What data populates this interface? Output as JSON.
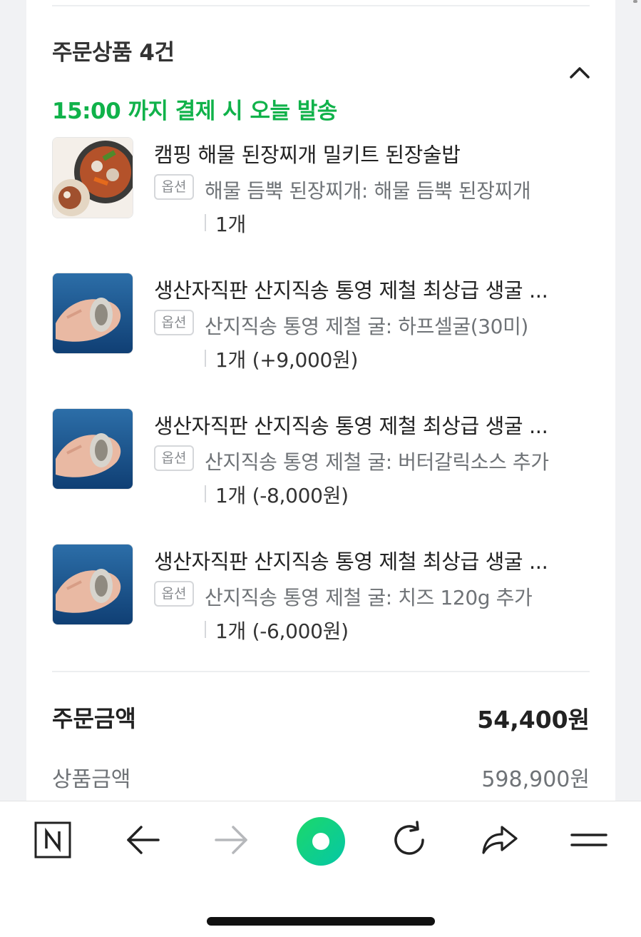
{
  "section": {
    "title": "주문상품 4건",
    "shipping_notice": "15:00 까지 결제 시 오늘 발송"
  },
  "items": [
    {
      "name": "캠핑 해물 된장찌개 밀키트 된장술밥",
      "option_badge": "옵션",
      "option": "해물 듬뿍 된장찌개: 해물 듬뿍 된장찌개",
      "quantity": "1개"
    },
    {
      "name": "생산자직판 산지직송 통영 제철 최상급 생굴 ...",
      "option_badge": "옵션",
      "option": "산지직송 통영 제철 굴: 하프셀굴(30미)",
      "quantity": "1개 (+9,000원)"
    },
    {
      "name": "생산자직판 산지직송 통영 제철 최상급 생굴 ...",
      "option_badge": "옵션",
      "option": "산지직송 통영 제철 굴: 버터갈릭소스 추가",
      "quantity": "1개 (-8,000원)"
    },
    {
      "name": "생산자직판 산지직송 통영 제철 최상급 생굴 ...",
      "option_badge": "옵션",
      "option": "산지직송 통영 제철 굴: 치즈 120g 추가",
      "quantity": "1개 (-6,000원)"
    }
  ],
  "summary": {
    "order_amount_label": "주문금액",
    "order_amount_value": "54,400원",
    "product_amount_label": "상품금액",
    "product_amount_value": "598,900원"
  },
  "toolbar": {
    "home_icon": "naver-n-icon",
    "back_icon": "arrow-left-icon",
    "forward_icon": "arrow-right-icon",
    "center_icon": "green-circle-icon",
    "reload_icon": "reload-icon",
    "share_icon": "share-icon",
    "menu_icon": "menu-icon"
  },
  "colors": {
    "accent_green": "#10b24a",
    "text_dark": "#222222",
    "text_gray": "#6f7377"
  }
}
